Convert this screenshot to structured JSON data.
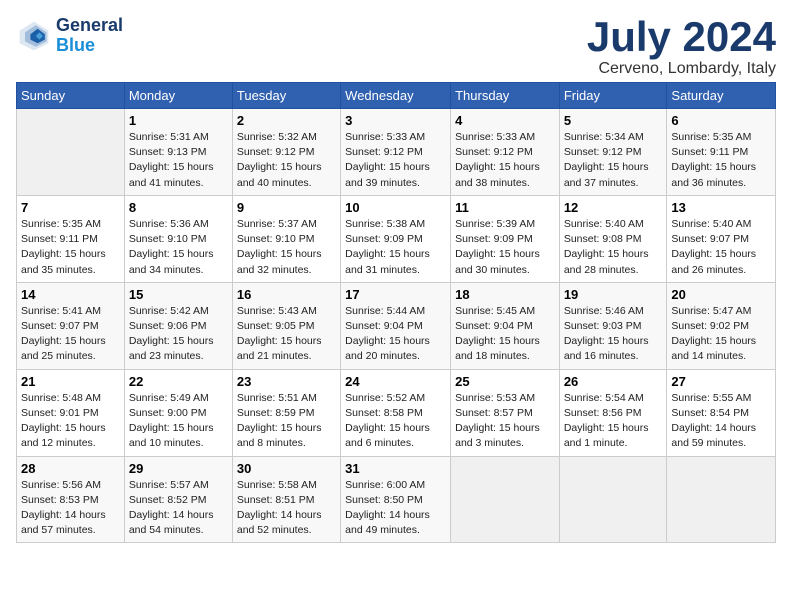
{
  "header": {
    "logo_line1": "General",
    "logo_line2": "Blue",
    "month": "July 2024",
    "location": "Cerveno, Lombardy, Italy"
  },
  "days_of_week": [
    "Sunday",
    "Monday",
    "Tuesday",
    "Wednesday",
    "Thursday",
    "Friday",
    "Saturday"
  ],
  "weeks": [
    [
      {
        "day": "",
        "empty": true
      },
      {
        "day": "1",
        "sunrise": "5:31 AM",
        "sunset": "9:13 PM",
        "daylight": "15 hours and 41 minutes."
      },
      {
        "day": "2",
        "sunrise": "5:32 AM",
        "sunset": "9:12 PM",
        "daylight": "15 hours and 40 minutes."
      },
      {
        "day": "3",
        "sunrise": "5:33 AM",
        "sunset": "9:12 PM",
        "daylight": "15 hours and 39 minutes."
      },
      {
        "day": "4",
        "sunrise": "5:33 AM",
        "sunset": "9:12 PM",
        "daylight": "15 hours and 38 minutes."
      },
      {
        "day": "5",
        "sunrise": "5:34 AM",
        "sunset": "9:12 PM",
        "daylight": "15 hours and 37 minutes."
      },
      {
        "day": "6",
        "sunrise": "5:35 AM",
        "sunset": "9:11 PM",
        "daylight": "15 hours and 36 minutes."
      }
    ],
    [
      {
        "day": "7",
        "sunrise": "5:35 AM",
        "sunset": "9:11 PM",
        "daylight": "15 hours and 35 minutes."
      },
      {
        "day": "8",
        "sunrise": "5:36 AM",
        "sunset": "9:10 PM",
        "daylight": "15 hours and 34 minutes."
      },
      {
        "day": "9",
        "sunrise": "5:37 AM",
        "sunset": "9:10 PM",
        "daylight": "15 hours and 32 minutes."
      },
      {
        "day": "10",
        "sunrise": "5:38 AM",
        "sunset": "9:09 PM",
        "daylight": "15 hours and 31 minutes."
      },
      {
        "day": "11",
        "sunrise": "5:39 AM",
        "sunset": "9:09 PM",
        "daylight": "15 hours and 30 minutes."
      },
      {
        "day": "12",
        "sunrise": "5:40 AM",
        "sunset": "9:08 PM",
        "daylight": "15 hours and 28 minutes."
      },
      {
        "day": "13",
        "sunrise": "5:40 AM",
        "sunset": "9:07 PM",
        "daylight": "15 hours and 26 minutes."
      }
    ],
    [
      {
        "day": "14",
        "sunrise": "5:41 AM",
        "sunset": "9:07 PM",
        "daylight": "15 hours and 25 minutes."
      },
      {
        "day": "15",
        "sunrise": "5:42 AM",
        "sunset": "9:06 PM",
        "daylight": "15 hours and 23 minutes."
      },
      {
        "day": "16",
        "sunrise": "5:43 AM",
        "sunset": "9:05 PM",
        "daylight": "15 hours and 21 minutes."
      },
      {
        "day": "17",
        "sunrise": "5:44 AM",
        "sunset": "9:04 PM",
        "daylight": "15 hours and 20 minutes."
      },
      {
        "day": "18",
        "sunrise": "5:45 AM",
        "sunset": "9:04 PM",
        "daylight": "15 hours and 18 minutes."
      },
      {
        "day": "19",
        "sunrise": "5:46 AM",
        "sunset": "9:03 PM",
        "daylight": "15 hours and 16 minutes."
      },
      {
        "day": "20",
        "sunrise": "5:47 AM",
        "sunset": "9:02 PM",
        "daylight": "15 hours and 14 minutes."
      }
    ],
    [
      {
        "day": "21",
        "sunrise": "5:48 AM",
        "sunset": "9:01 PM",
        "daylight": "15 hours and 12 minutes."
      },
      {
        "day": "22",
        "sunrise": "5:49 AM",
        "sunset": "9:00 PM",
        "daylight": "15 hours and 10 minutes."
      },
      {
        "day": "23",
        "sunrise": "5:51 AM",
        "sunset": "8:59 PM",
        "daylight": "15 hours and 8 minutes."
      },
      {
        "day": "24",
        "sunrise": "5:52 AM",
        "sunset": "8:58 PM",
        "daylight": "15 hours and 6 minutes."
      },
      {
        "day": "25",
        "sunrise": "5:53 AM",
        "sunset": "8:57 PM",
        "daylight": "15 hours and 3 minutes."
      },
      {
        "day": "26",
        "sunrise": "5:54 AM",
        "sunset": "8:56 PM",
        "daylight": "15 hours and 1 minute."
      },
      {
        "day": "27",
        "sunrise": "5:55 AM",
        "sunset": "8:54 PM",
        "daylight": "14 hours and 59 minutes."
      }
    ],
    [
      {
        "day": "28",
        "sunrise": "5:56 AM",
        "sunset": "8:53 PM",
        "daylight": "14 hours and 57 minutes."
      },
      {
        "day": "29",
        "sunrise": "5:57 AM",
        "sunset": "8:52 PM",
        "daylight": "14 hours and 54 minutes."
      },
      {
        "day": "30",
        "sunrise": "5:58 AM",
        "sunset": "8:51 PM",
        "daylight": "14 hours and 52 minutes."
      },
      {
        "day": "31",
        "sunrise": "6:00 AM",
        "sunset": "8:50 PM",
        "daylight": "14 hours and 49 minutes."
      },
      {
        "day": "",
        "empty": true
      },
      {
        "day": "",
        "empty": true
      },
      {
        "day": "",
        "empty": true
      }
    ]
  ]
}
